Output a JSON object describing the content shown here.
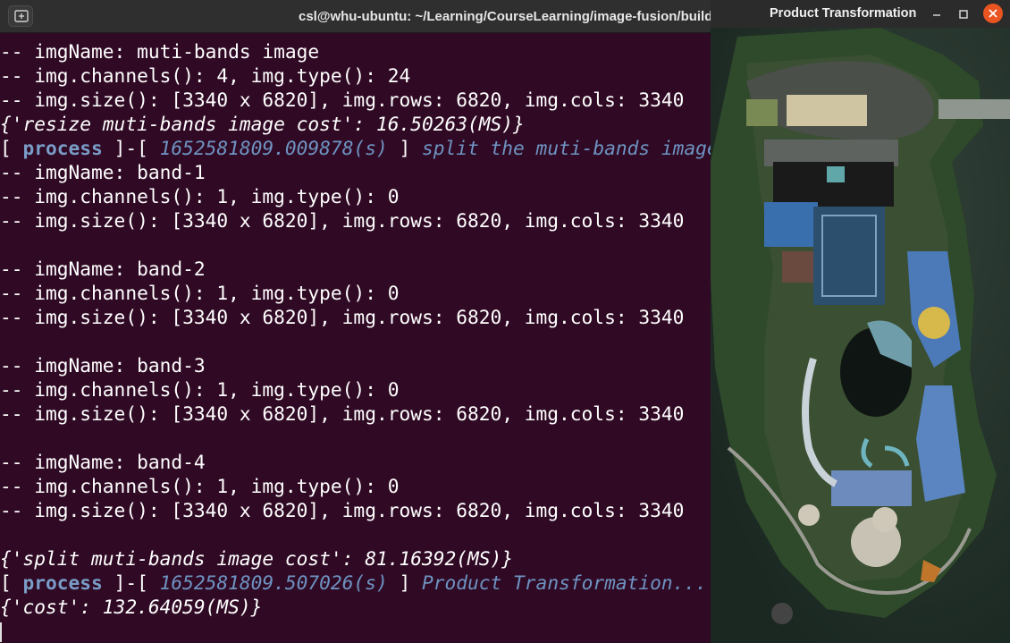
{
  "terminal": {
    "title": "csl@whu-ubuntu: ~/Learning/CourseLearning/image-fusion/build",
    "lines": {
      "l1": "-- imgName: muti-bands image",
      "l2": "-- img.channels(): 4, img.type(): 24",
      "l3": "-- img.size(): [3340 x 6820], img.rows: 6820, img.cols: 3340",
      "l4": "{'resize muti-bands image cost': 16.50263(MS)}",
      "l5_open": "[ ",
      "l5_tag": "process",
      "l5_mid": " ]-[ ",
      "l5_ts": "1652581809.009878(s)",
      "l5_close": " ] ",
      "l5_msg": "split the muti-bands image",
      "l6": "-- imgName: band-1",
      "l7": "-- img.channels(): 1, img.type(): 0",
      "l8": "-- img.size(): [3340 x 6820], img.rows: 6820, img.cols: 3340",
      "l10": "-- imgName: band-2",
      "l11": "-- img.channels(): 1, img.type(): 0",
      "l12": "-- img.size(): [3340 x 6820], img.rows: 6820, img.cols: 3340",
      "l14": "-- imgName: band-3",
      "l15": "-- img.channels(): 1, img.type(): 0",
      "l16": "-- img.size(): [3340 x 6820], img.rows: 6820, img.cols: 3340",
      "l18": "-- imgName: band-4",
      "l19": "-- img.channels(): 1, img.type(): 0",
      "l20": "-- img.size(): [3340 x 6820], img.rows: 6820, img.cols: 3340",
      "l22": "{'split muti-bands image cost': 81.16392(MS)}",
      "l23_open": "[ ",
      "l23_tag": "process",
      "l23_mid": " ]-[ ",
      "l23_ts": "1652581809.507026(s)",
      "l23_close": " ] ",
      "l23_msg": "Product Transformation...",
      "l24": "{'cost': 132.64059(MS)}"
    }
  },
  "viewer": {
    "title": "Product Transformation"
  },
  "colors": {
    "terminal_bg": "#300a24",
    "titlebar_bg": "#2f2f2f",
    "tag_blue": "#7a9cc8",
    "close_orange": "#e95420"
  },
  "icons": [
    "new-tab-icon",
    "minimize-icon",
    "maximize-icon",
    "close-icon"
  ]
}
